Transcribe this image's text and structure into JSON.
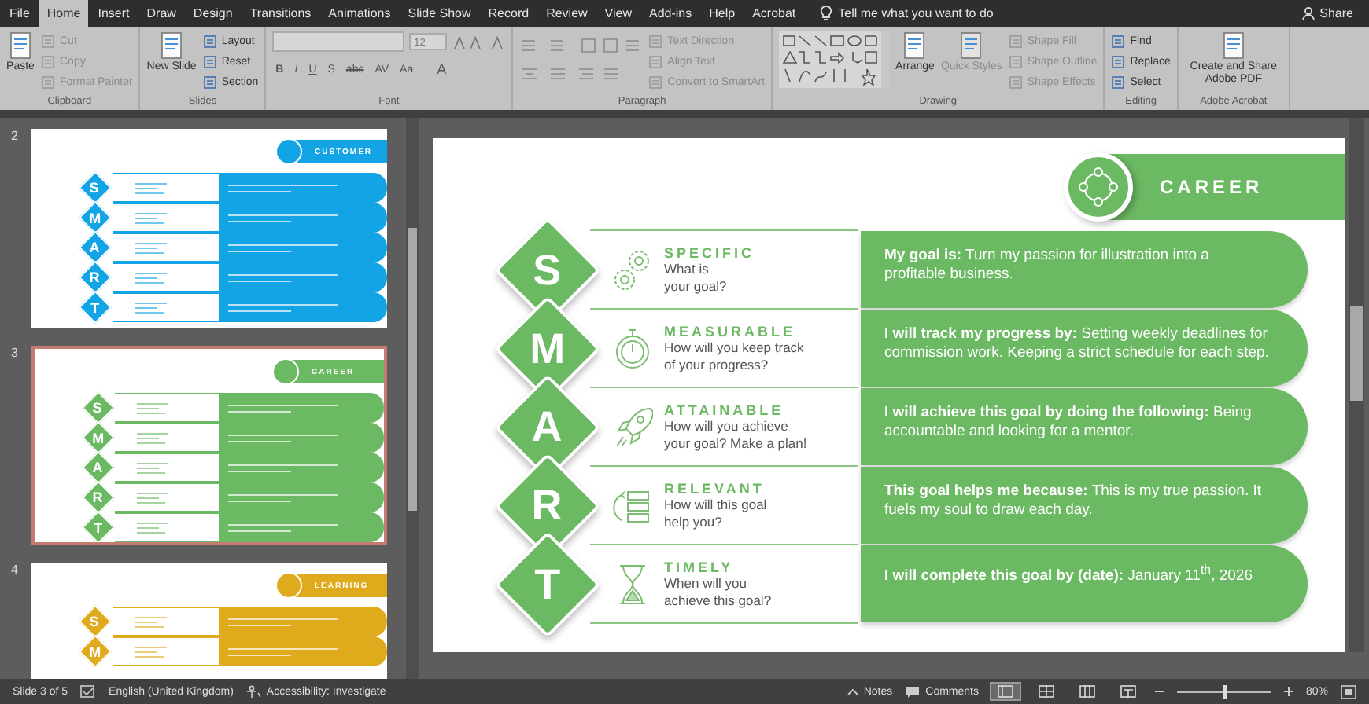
{
  "tabs": [
    {
      "label": "File",
      "selected": false
    },
    {
      "label": "Home",
      "selected": true
    },
    {
      "label": "Insert",
      "selected": false
    },
    {
      "label": "Draw",
      "selected": false
    },
    {
      "label": "Design",
      "selected": false
    },
    {
      "label": "Transitions",
      "selected": false
    },
    {
      "label": "Animations",
      "selected": false
    },
    {
      "label": "Slide Show",
      "selected": false
    },
    {
      "label": "Record",
      "selected": false
    },
    {
      "label": "Review",
      "selected": false
    },
    {
      "label": "View",
      "selected": false
    },
    {
      "label": "Add-ins",
      "selected": false
    },
    {
      "label": "Help",
      "selected": false
    },
    {
      "label": "Acrobat",
      "selected": false
    }
  ],
  "tell_me": {
    "placeholder": "Tell me what you want to do"
  },
  "share": "Share",
  "ribbon": [
    {
      "kind": "stack",
      "label": "Clipboard",
      "items": [
        {
          "kind": "large",
          "label": "Paste",
          "disabled": false
        },
        {
          "kind": "small",
          "label": "Cut",
          "disabled": true
        },
        {
          "kind": "small",
          "label": "Copy",
          "disabled": true
        },
        {
          "kind": "small",
          "label": "Format Painter",
          "disabled": true
        }
      ]
    },
    {
      "kind": "stack",
      "label": "Slides",
      "items": [
        {
          "kind": "large",
          "label": "New Slide",
          "disabled": false
        },
        {
          "kind": "small",
          "label": "Layout",
          "disabled": false
        },
        {
          "kind": "small",
          "label": "Reset",
          "disabled": false
        },
        {
          "kind": "small",
          "label": "Section",
          "disabled": false
        }
      ]
    },
    {
      "kind": "font",
      "label": "Font",
      "font_size": "12",
      "glyphs": [
        "B",
        "I",
        "U",
        "S",
        "abc",
        "AV",
        "Aa",
        "A"
      ]
    },
    {
      "kind": "paragraph",
      "label": "Paragraph",
      "items": [
        {
          "kind": "small",
          "label": "Text Direction",
          "disabled": true
        },
        {
          "kind": "small",
          "label": "Align Text",
          "disabled": true
        },
        {
          "kind": "small",
          "label": "Convert to SmartArt",
          "disabled": true
        }
      ]
    },
    {
      "kind": "drawing",
      "label": "Drawing",
      "items": [
        {
          "kind": "large",
          "label": "Arrange",
          "disabled": false
        },
        {
          "kind": "large",
          "label": "Quick Styles",
          "disabled": true
        },
        {
          "kind": "small",
          "label": "Shape Fill",
          "disabled": true
        },
        {
          "kind": "small",
          "label": "Shape Outline",
          "disabled": true
        },
        {
          "kind": "small",
          "label": "Shape Effects",
          "disabled": true
        }
      ]
    },
    {
      "kind": "stack",
      "label": "Editing",
      "items": [
        {
          "kind": "small",
          "label": "Find",
          "disabled": false
        },
        {
          "kind": "small",
          "label": "Replace",
          "disabled": false
        },
        {
          "kind": "small",
          "label": "Select",
          "disabled": false
        }
      ]
    },
    {
      "kind": "stack",
      "label": "Adobe Acrobat",
      "items": [
        {
          "kind": "large",
          "label": "Create and Share Adobe PDF",
          "disabled": false
        }
      ]
    }
  ],
  "thumbnails": [
    {
      "number": "2",
      "title": "CUSTOMER",
      "color": "#12a4e4",
      "selected": false,
      "letters": [
        "S",
        "M",
        "A",
        "R",
        "T"
      ]
    },
    {
      "number": "3",
      "title": "CAREER",
      "color": "#6cb963",
      "selected": true,
      "letters": [
        "S",
        "M",
        "A",
        "R",
        "T"
      ]
    },
    {
      "number": "4",
      "title": "LEARNING",
      "color": "#dfaa1c",
      "selected": false,
      "letters": [
        "S",
        "M"
      ]
    }
  ],
  "slide": {
    "title": "CAREER",
    "rows": [
      {
        "letter": "S",
        "heading": "SPECIFIC",
        "question": "What is\nyour goal?",
        "answer": "**My goal is:** Turn my passion for illustration into a profitable business."
      },
      {
        "letter": "M",
        "heading": "MEASURABLE",
        "question": "How will you keep track\nof your progress?",
        "answer": "**I will track my progress by:** Setting weekly deadlines for commission work. Keeping a strict schedule for each step."
      },
      {
        "letter": "A",
        "heading": "ATTAINABLE",
        "question": "How will you achieve\nyour goal? Make a plan!",
        "answer": "**I will achieve this goal by doing the following:** Being accountable and looking for a mentor."
      },
      {
        "letter": "R",
        "heading": "RELEVANT",
        "question": "How will this goal\nhelp you?",
        "answer": "**This goal helps me because:** This is my true passion. It fuels my soul to draw each day."
      },
      {
        "letter": "T",
        "heading": "TIMELY",
        "question": "When will you\nachieve this goal?",
        "answer": "**I will complete this goal by (date):** January 11$^{th}$, 2026"
      }
    ]
  },
  "status": {
    "slide": "Slide 3 of 5",
    "language": "English (United Kingdom)",
    "accessibility": "Accessibility: Investigate",
    "notes": "Notes",
    "comments": "Comments",
    "views": [
      {
        "selected": true
      },
      {
        "selected": false
      },
      {
        "selected": false
      },
      {
        "selected": false
      }
    ],
    "zoom": {
      "level": 0.5,
      "reading": "80%"
    }
  }
}
